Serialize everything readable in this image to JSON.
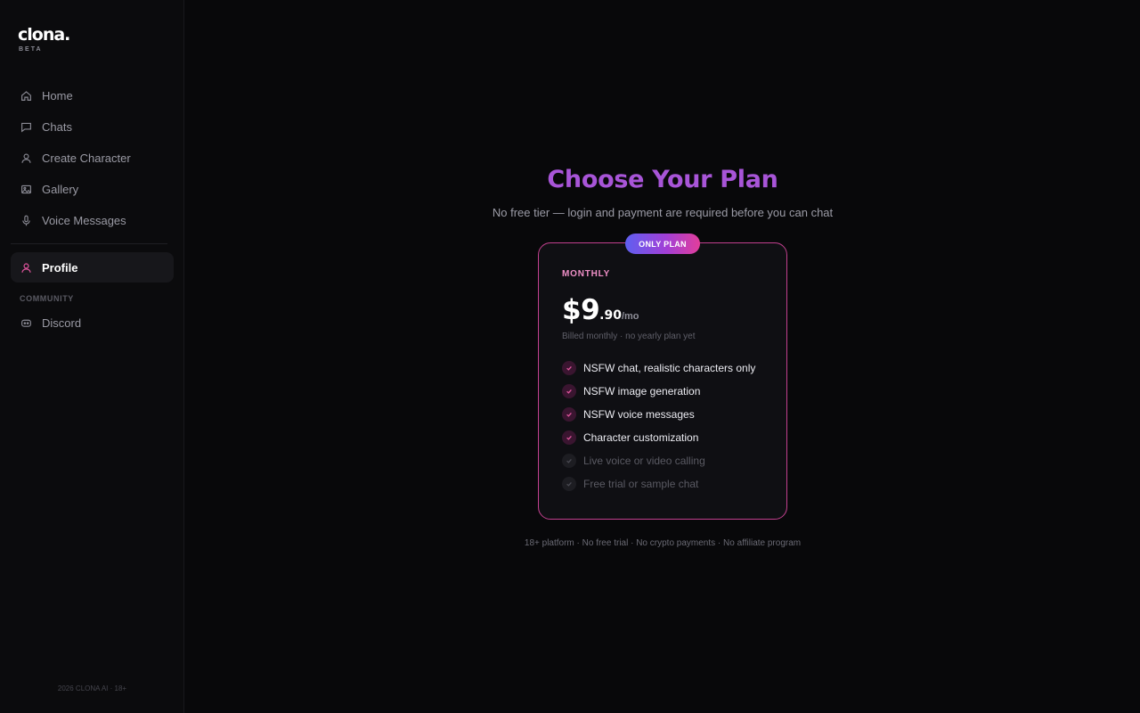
{
  "brand": {
    "name": "clona.",
    "badge": "BETA"
  },
  "sidebar": {
    "items": [
      {
        "label": "Home",
        "icon": "home-icon"
      },
      {
        "label": "Chats",
        "icon": "chat-icon"
      },
      {
        "label": "Create Character",
        "icon": "user-icon"
      },
      {
        "label": "Gallery",
        "icon": "image-icon"
      },
      {
        "label": "Voice Messages",
        "icon": "mic-icon"
      }
    ],
    "profile": {
      "label": "Profile",
      "icon": "user-icon",
      "active": true
    },
    "community_label": "COMMUNITY",
    "community_items": [
      {
        "label": "Discord",
        "icon": "discord-icon"
      }
    ],
    "footer": "2026 CLONA AI · 18+"
  },
  "main": {
    "title": "Choose Your Plan",
    "subtitle": "No free tier — login and payment are required before you can chat",
    "footnote": "18+ platform · No free trial · No crypto payments · No affiliate program"
  },
  "plan": {
    "badge": "ONLY PLAN",
    "name": "MONTHLY",
    "price_main": "$9",
    "price_cents": ".90",
    "price_per": "/mo",
    "billing_note": "Billed monthly · no yearly plan yet",
    "features": [
      {
        "label": "NSFW chat, realistic characters only",
        "included": true
      },
      {
        "label": "NSFW image generation",
        "included": true
      },
      {
        "label": "NSFW voice messages",
        "included": true
      },
      {
        "label": "Character customization",
        "included": true
      },
      {
        "label": "Live voice or video calling",
        "included": false
      },
      {
        "label": "Free trial or sample chat",
        "included": false
      }
    ]
  },
  "colors": {
    "accent_title": "#a855d8",
    "card_border": "#c2408f",
    "plan_name": "#ef8fc7",
    "check_included": "#e0559e"
  }
}
